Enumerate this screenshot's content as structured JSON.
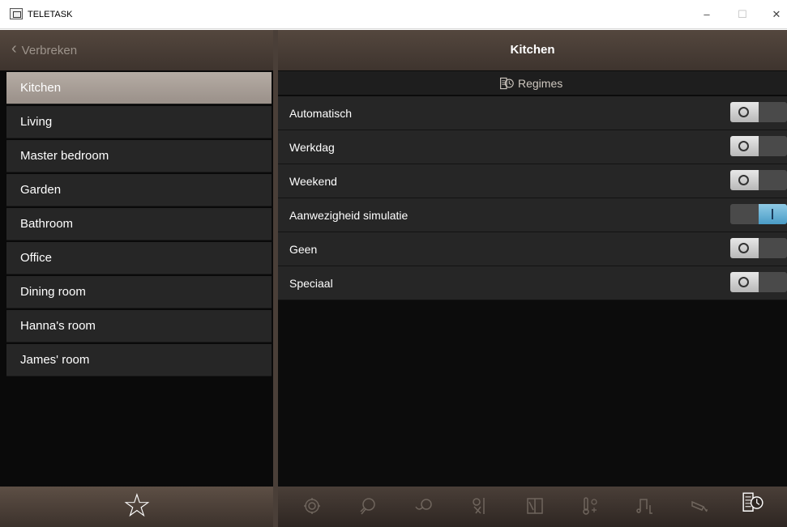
{
  "window": {
    "title": "TELETASK",
    "minimize": "–",
    "maximize": "☐",
    "close": "✕"
  },
  "left": {
    "back_label": "Verbreken",
    "rooms": [
      "Kitchen",
      "Living",
      "Master bedroom",
      "Garden",
      "Bathroom",
      "Office",
      "Dining room",
      "Hanna's room",
      "James' room"
    ],
    "active_room": "Kitchen",
    "favorite_icon": "star-icon"
  },
  "right": {
    "title": "Kitchen",
    "section": "Regimes",
    "regimes": [
      {
        "label": "Automatisch",
        "state": "off"
      },
      {
        "label": "Werkdag",
        "state": "off"
      },
      {
        "label": "Weekend",
        "state": "off"
      },
      {
        "label": "Aanwezigheid simulatie",
        "state": "on"
      },
      {
        "label": "Geen",
        "state": "off"
      },
      {
        "label": "Speciaal",
        "state": "off"
      }
    ],
    "nav_icons": [
      "scene-icon",
      "lightbulb-icon",
      "motor-icon",
      "sensor-icon",
      "door-icon",
      "temperature-icon",
      "music-icon",
      "camera-icon",
      "regimes-icon"
    ],
    "active_nav": "regimes-icon"
  },
  "colors": {
    "header_brown": "#4a3f38",
    "active_item": "#a89f97",
    "list_item": "#262626",
    "toggle_on": "#6bb3d8"
  }
}
